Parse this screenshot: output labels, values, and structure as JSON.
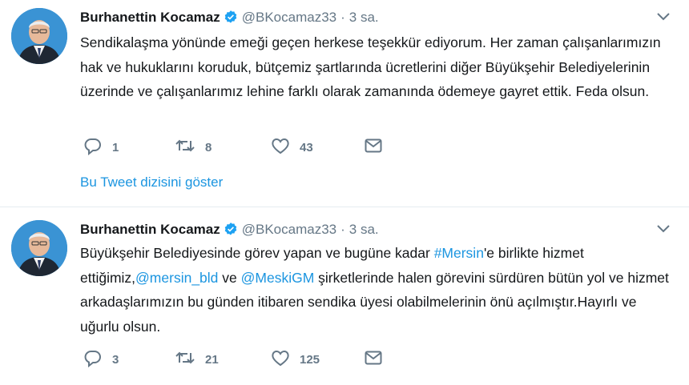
{
  "tweets": [
    {
      "author_name": "Burhanettin Kocamaz",
      "handle": "@BKocamaz33",
      "separator": "·",
      "time": "3 sa.",
      "text": "Sendikalaşma yönünde emeği geçen herkese teşekkür ediyorum. Her zaman çalışanlarımızın hak ve hukuklarını koruduk, bütçemiz şartlarında ücretlerini diğer Büyükşehir Belediyelerinin üzerinde ve çalışanlarımız lehine farklı olarak zamanında ödemeye gayret ettik. Feda olsun.",
      "replies": "1",
      "retweets": "8",
      "likes": "43",
      "show_thread": "Bu Tweet dizisini göster"
    },
    {
      "author_name": "Burhanettin Kocamaz",
      "handle": "@BKocamaz33",
      "separator": "·",
      "time": "3 sa.",
      "text_parts": {
        "p1": "Büyükşehir Belediyesinde görev yapan ve bugüne kadar ",
        "hashtag": "#Mersin",
        "p2": "'e birlikte hizmet ettiğimiz,",
        "mention1": "@mersin_bld",
        "p3": " ve ",
        "mention2": "@MeskiGM",
        "p4": " şirketlerinde halen görevini sürdüren bütün yol ve hizmet arkadaşlarımızın bu günden itibaren sendika üyesi olabilmelerinin önü açılmıştır.Hayırlı ve uğurlu olsun."
      },
      "replies": "3",
      "retweets": "21",
      "likes": "125"
    }
  ],
  "colors": {
    "link": "#1b95e0",
    "muted": "#657786",
    "text": "#14171a",
    "divider": "#e6ecf0",
    "verified": "#1da1f2"
  },
  "icons": [
    "avatar",
    "verified-badge-icon",
    "chevron-down-icon",
    "reply-icon",
    "retweet-icon",
    "heart-icon",
    "direct-message-icon"
  ]
}
